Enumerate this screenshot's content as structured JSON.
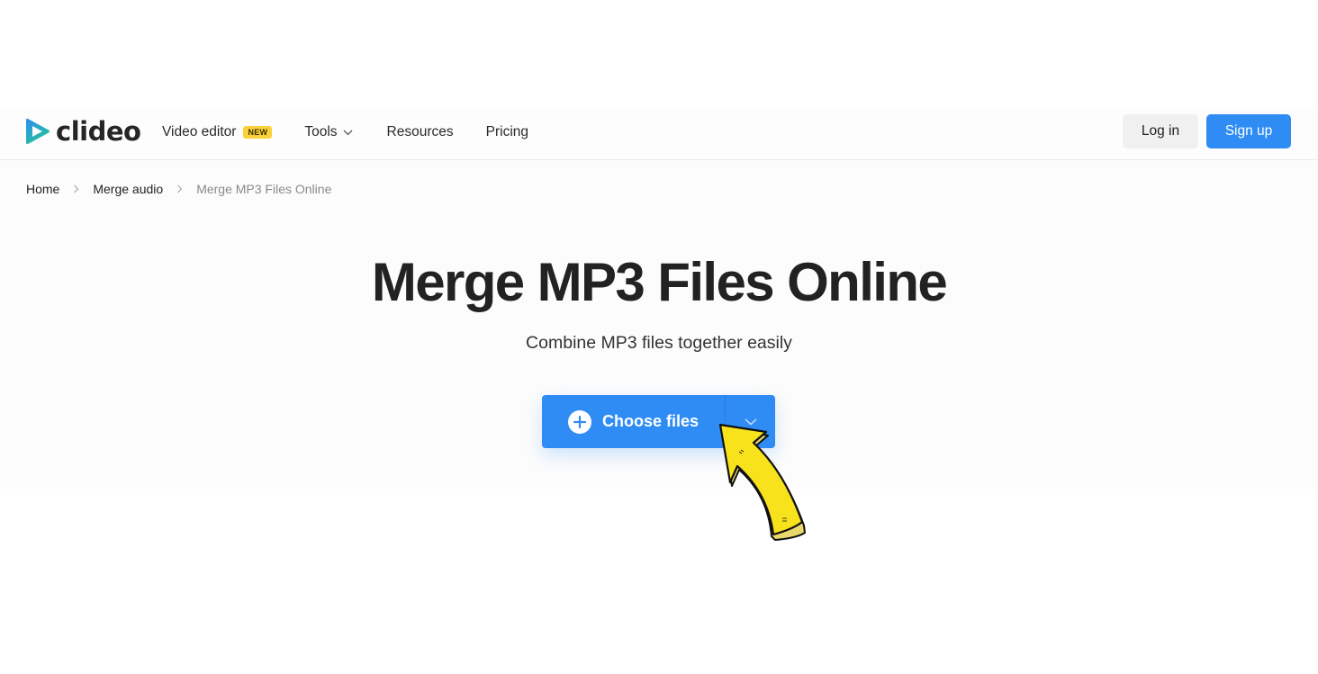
{
  "header": {
    "logo_text": "clideo",
    "nav": [
      {
        "label": "Video editor",
        "badge": "NEW"
      },
      {
        "label": "Tools",
        "has_dropdown": true
      },
      {
        "label": "Resources"
      },
      {
        "label": "Pricing"
      }
    ],
    "login_label": "Log in",
    "signup_label": "Sign up"
  },
  "breadcrumb": [
    {
      "label": "Home"
    },
    {
      "label": "Merge audio"
    },
    {
      "label": "Merge MP3 Files Online",
      "current": true
    }
  ],
  "hero": {
    "title": "Merge MP3 Files Online",
    "subtitle": "Combine MP3 files together easily",
    "choose_files_label": "Choose files"
  },
  "colors": {
    "brand_blue": "#2f8cf4",
    "badge_yellow": "#fbd13a",
    "annotation_arrow": "#f7e21c"
  },
  "icons": {
    "logo": "play-triangle-gradient-icon",
    "tools_dropdown": "chevron-down-icon",
    "breadcrumb_separator": "chevron-right-icon",
    "choose_files": "plus-circle-icon",
    "choose_files_dropdown": "chevron-down-icon",
    "annotation": "curved-arrow-pointer-icon"
  }
}
